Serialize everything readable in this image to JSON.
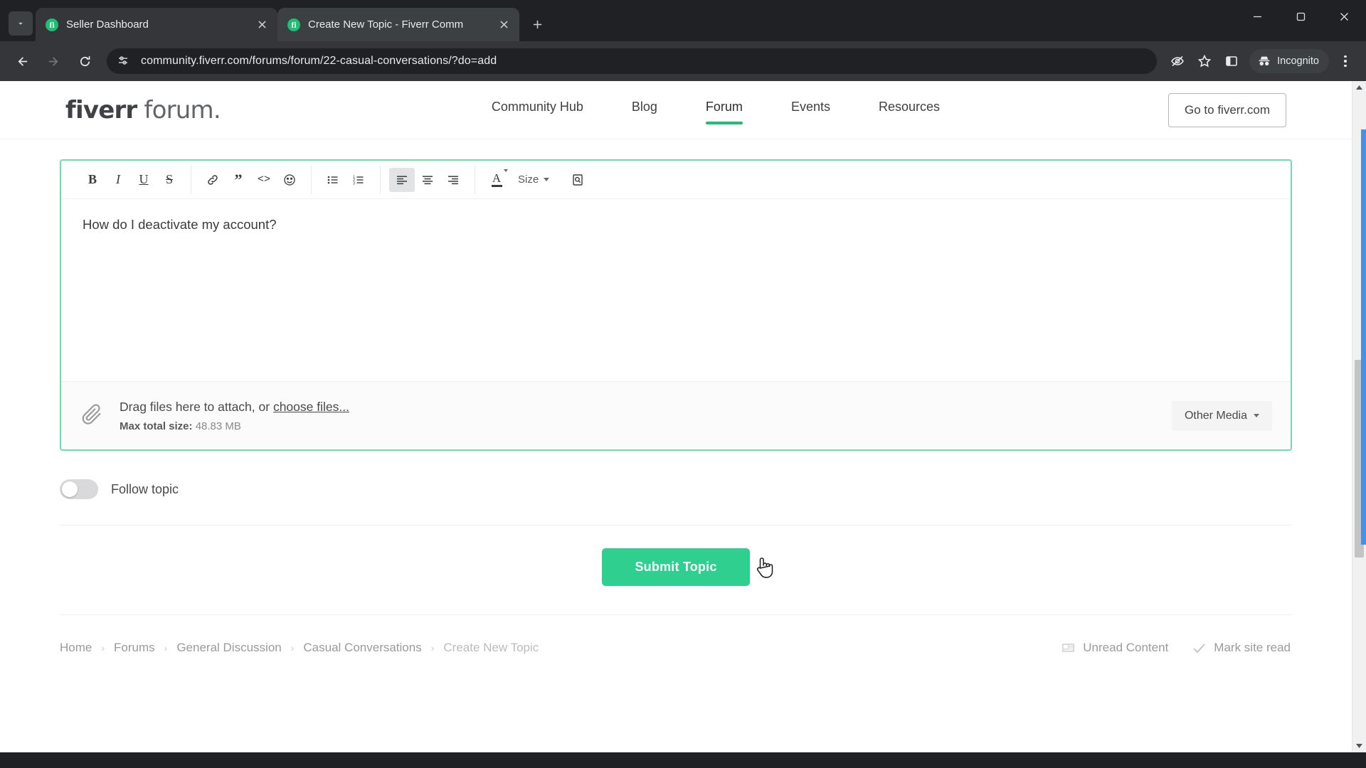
{
  "browser": {
    "tabs": [
      {
        "title": "Seller Dashboard",
        "favicon": "fiverr-favicon",
        "active": false
      },
      {
        "title": "Create New Topic - Fiverr Comm",
        "favicon": "fiverr-favicon",
        "active": true
      }
    ],
    "new_tab_label": "+",
    "url": "community.fiverr.com/forums/forum/22-casual-conversations/?do=add",
    "profile_label": "Incognito",
    "window_controls": [
      "minimize",
      "maximize",
      "close"
    ],
    "toolbar_icons": [
      "back-arrow",
      "forward-arrow",
      "reload",
      "site-settings",
      "tracking-protection",
      "bookmark-star",
      "side-panel",
      "incognito",
      "more-menu"
    ]
  },
  "site": {
    "logo_bold": "fiverr",
    "logo_light": " forum.",
    "nav": [
      {
        "label": "Community Hub",
        "active": false
      },
      {
        "label": "Blog",
        "active": false
      },
      {
        "label": "Forum",
        "active": true
      },
      {
        "label": "Events",
        "active": false
      },
      {
        "label": "Resources",
        "active": false
      }
    ],
    "cta_label": "Go to fiverr.com",
    "accent_color": "#1dbf73"
  },
  "editor": {
    "toolbar": {
      "groups": [
        [
          {
            "name": "bold",
            "glyph": "B"
          },
          {
            "name": "italic",
            "glyph": "I"
          },
          {
            "name": "underline",
            "glyph": "U"
          },
          {
            "name": "strikethrough",
            "glyph": "S"
          }
        ],
        [
          {
            "name": "link",
            "glyph": "link"
          },
          {
            "name": "quote",
            "glyph": "”"
          },
          {
            "name": "code",
            "glyph": "<>"
          },
          {
            "name": "emoji",
            "glyph": "emoji"
          }
        ],
        [
          {
            "name": "bullet-list",
            "glyph": "list-ul"
          },
          {
            "name": "numbered-list",
            "glyph": "list-ol"
          }
        ],
        [
          {
            "name": "align-left",
            "glyph": "align-left",
            "active": true
          },
          {
            "name": "align-center",
            "glyph": "align-center"
          },
          {
            "name": "align-right",
            "glyph": "align-right"
          }
        ],
        [
          {
            "name": "text-color",
            "glyph": "A"
          },
          {
            "name": "size",
            "glyph": "Size"
          },
          {
            "name": "preview",
            "glyph": "preview"
          }
        ]
      ],
      "size_label": "Size"
    },
    "body_text": "How do I deactivate my account?",
    "border_color": "#6fdcac"
  },
  "attachments": {
    "prompt_prefix": "Drag files here to attach, or ",
    "choose_files_label": "choose files...",
    "max_size_label": "Max total size:",
    "max_size_value": "48.83 MB",
    "other_media_label": "Other Media"
  },
  "follow": {
    "label": "Follow topic",
    "enabled": false
  },
  "submit": {
    "label": "Submit Topic",
    "color": "#2fcf8f"
  },
  "breadcrumb": [
    {
      "label": "Home",
      "current": false
    },
    {
      "label": "Forums",
      "current": false
    },
    {
      "label": "General Discussion",
      "current": false
    },
    {
      "label": "Casual Conversations",
      "current": false
    },
    {
      "label": "Create New Topic",
      "current": true
    }
  ],
  "breadcrumb_separator": "›",
  "footer_actions": [
    {
      "label": "Unread Content",
      "icon": "newspaper-icon"
    },
    {
      "label": "Mark site read",
      "icon": "check-icon"
    }
  ]
}
